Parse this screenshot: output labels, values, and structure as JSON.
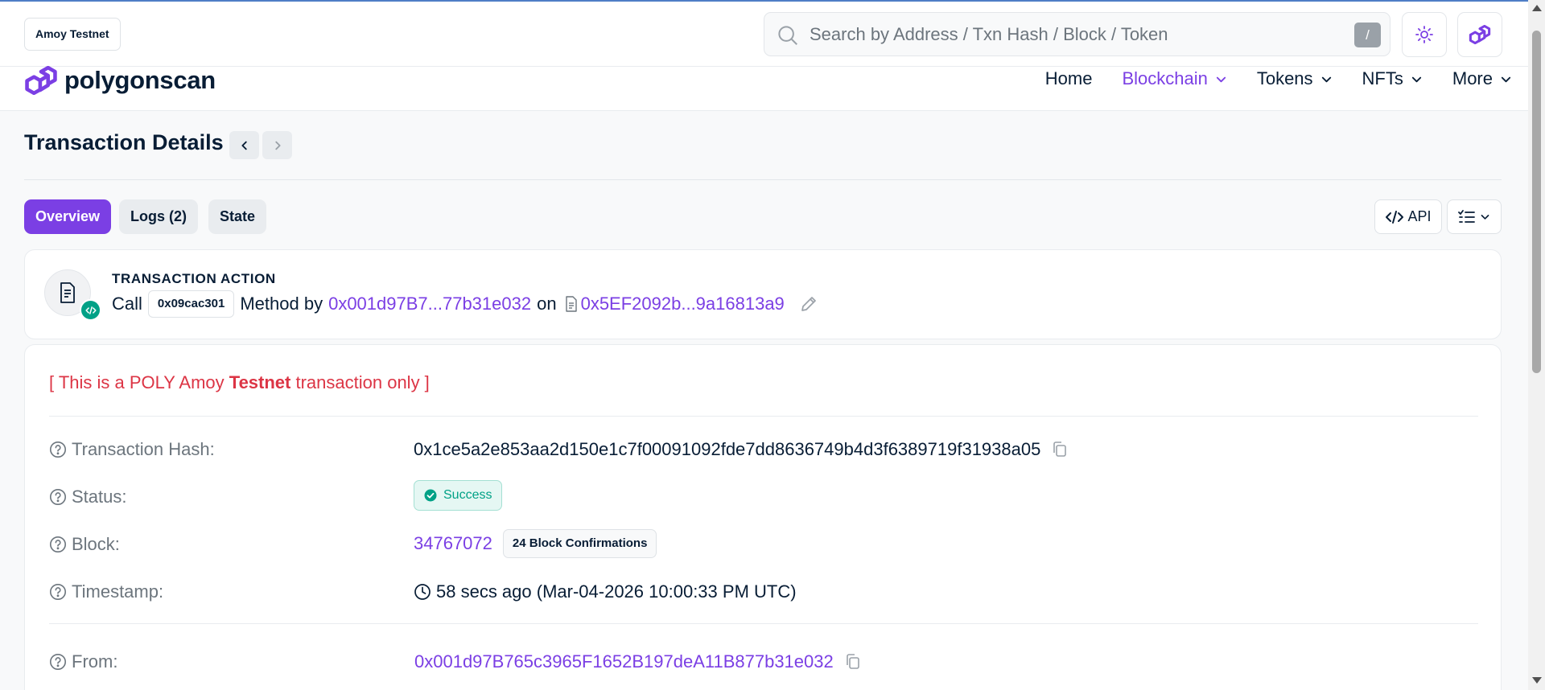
{
  "network": "Amoy Testnet",
  "search": {
    "placeholder": "Search by Address / Txn Hash / Block / Token",
    "shortcut": "/"
  },
  "brand": {
    "name": "polygonscan"
  },
  "nav": {
    "items": [
      {
        "label": "Home",
        "active": false,
        "dropdown": false
      },
      {
        "label": "Blockchain",
        "active": true,
        "dropdown": true
      },
      {
        "label": "Tokens",
        "active": false,
        "dropdown": true
      },
      {
        "label": "NFTs",
        "active": false,
        "dropdown": true
      },
      {
        "label": "More",
        "active": false,
        "dropdown": true
      }
    ]
  },
  "page": {
    "title": "Transaction Details"
  },
  "tabs": [
    {
      "label": "Overview",
      "active": true
    },
    {
      "label": "Logs (2)",
      "active": false
    },
    {
      "label": "State",
      "active": false
    }
  ],
  "toolbar": {
    "api_label": "API"
  },
  "action": {
    "heading": "TRANSACTION ACTION",
    "call": "Call",
    "method": "0x09cac301",
    "method_by": "Method by",
    "from_short": "0x001d97B7...77b31e032",
    "on": "on",
    "to_short": "0x5EF2092b...9a16813a9"
  },
  "notice": {
    "prefix": "[ This is a POLY Amoy ",
    "bold": "Testnet",
    "suffix": " transaction only ]"
  },
  "details": {
    "tx_hash_label": "Transaction Hash:",
    "tx_hash": "0x1ce5a2e853aa2d150e1c7f00091092fde7dd8636749b4d3f6389719f31938a05",
    "status_label": "Status:",
    "status": "Success",
    "block_label": "Block:",
    "block": "34767072",
    "confirmations": "24 Block Confirmations",
    "timestamp_label": "Timestamp:",
    "timestamp": "58 secs ago (Mar-04-2026 10:00:33 PM UTC)",
    "from_label": "From:",
    "from": "0x001d97B765c3965F1652B197deA11B877b31e032"
  },
  "colors": {
    "accent": "#7b3fe4",
    "success": "#00a186",
    "danger": "#dc3545",
    "text": "#081d35",
    "muted": "#6c757d"
  },
  "icons": [
    "search-icon",
    "sun-icon",
    "polygon-logo-icon",
    "chevron-down-icon",
    "chevron-left-icon",
    "chevron-right-icon",
    "code-icon",
    "list-settings-icon",
    "document-icon",
    "code-badge-icon",
    "pencil-icon",
    "help-circle-icon",
    "copy-icon",
    "check-circle-icon",
    "clock-icon"
  ]
}
